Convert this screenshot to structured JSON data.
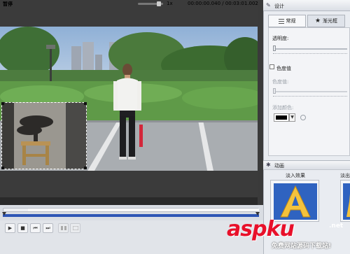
{
  "player": {
    "status": "暂停",
    "speed": "1x",
    "timecode": "00:00:00.040 / 00:03:01.002",
    "progress": 0.0002
  },
  "transport": {
    "play_icon": "▶",
    "stop_icon": "■",
    "prev_icon": "⏮",
    "next_icon": "⏭"
  },
  "panel": {
    "design_title": "设计",
    "tabs": [
      {
        "label": "常规",
        "icon": "list-icon"
      },
      {
        "label": "渐光框",
        "icon": "star-icon"
      }
    ],
    "opacity_label": "透明度:",
    "chroma_label": "色度值",
    "chroma_value_label": "色度值:",
    "add_color_label": "添加颜色:",
    "selected_color": "#000000"
  },
  "animation": {
    "title": "动画",
    "fade_in_label": "淡入效果",
    "fade_out_label": "淡出"
  },
  "watermark": {
    "main": "aspku",
    "net": ".net",
    "sub": "免费网站源码下载站!"
  }
}
